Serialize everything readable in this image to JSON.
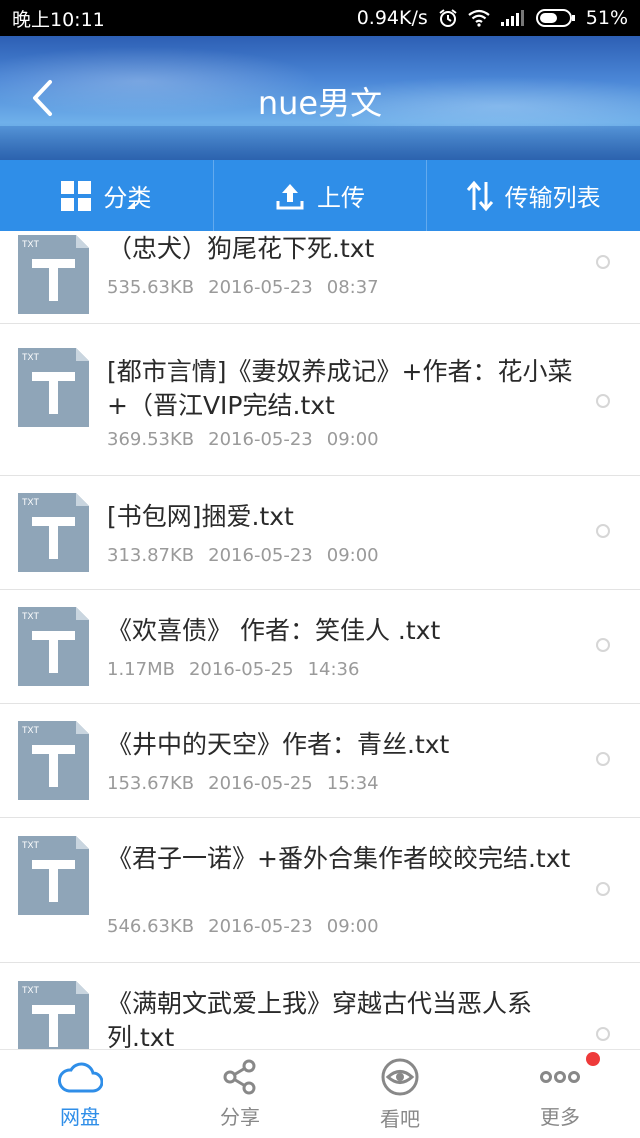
{
  "status_bar": {
    "time": "晚上10:11",
    "speed": "0.94K/s",
    "battery": "51%"
  },
  "header": {
    "title": "nue男文",
    "back_icon": "chevron-left-icon"
  },
  "toolbar": {
    "category_label": "分类",
    "upload_label": "上传",
    "transfer_label": "传输列表"
  },
  "files": [
    {
      "name": "（忠犬）狗尾花下死.txt",
      "size": "535.63KB",
      "date": "2016-05-23",
      "time": "08:37",
      "icon_label": "TXT"
    },
    {
      "name": "[都市言情]《妻奴养成记》+作者：花小菜+（晋江VIP完结.txt",
      "size": "369.53KB",
      "date": "2016-05-23",
      "time": "09:00",
      "icon_label": "TXT"
    },
    {
      "name": "[书包网]捆爱.txt",
      "size": "313.87KB",
      "date": "2016-05-23",
      "time": "09:00",
      "icon_label": "TXT"
    },
    {
      "name": "《欢喜债》 作者：笑佳人 .txt",
      "size": "1.17MB",
      "date": "2016-05-25",
      "time": "14:36",
      "icon_label": "TXT"
    },
    {
      "name": "《井中的天空》作者：青丝.txt",
      "size": "153.67KB",
      "date": "2016-05-25",
      "time": "15:34",
      "icon_label": "TXT"
    },
    {
      "name": "《君子一诺》+番外合集作者皎皎完结.txt",
      "size": "546.63KB",
      "date": "2016-05-23",
      "time": "09:00",
      "icon_label": "TXT"
    },
    {
      "name": "《满朝文武爱上我》穿越古代当恶人系列.txt",
      "size": "",
      "date": "",
      "time": "",
      "icon_label": "TXT"
    }
  ],
  "bottom_nav": {
    "items": [
      {
        "label": "网盘",
        "icon": "cloud-icon",
        "active": true
      },
      {
        "label": "分享",
        "icon": "share-icon",
        "active": false
      },
      {
        "label": "看吧",
        "icon": "eye-icon",
        "active": false
      },
      {
        "label": "更多",
        "icon": "more-icon",
        "active": false
      }
    ]
  },
  "colors": {
    "accent": "#2f8ee8",
    "badge": "#ee3a3a"
  }
}
